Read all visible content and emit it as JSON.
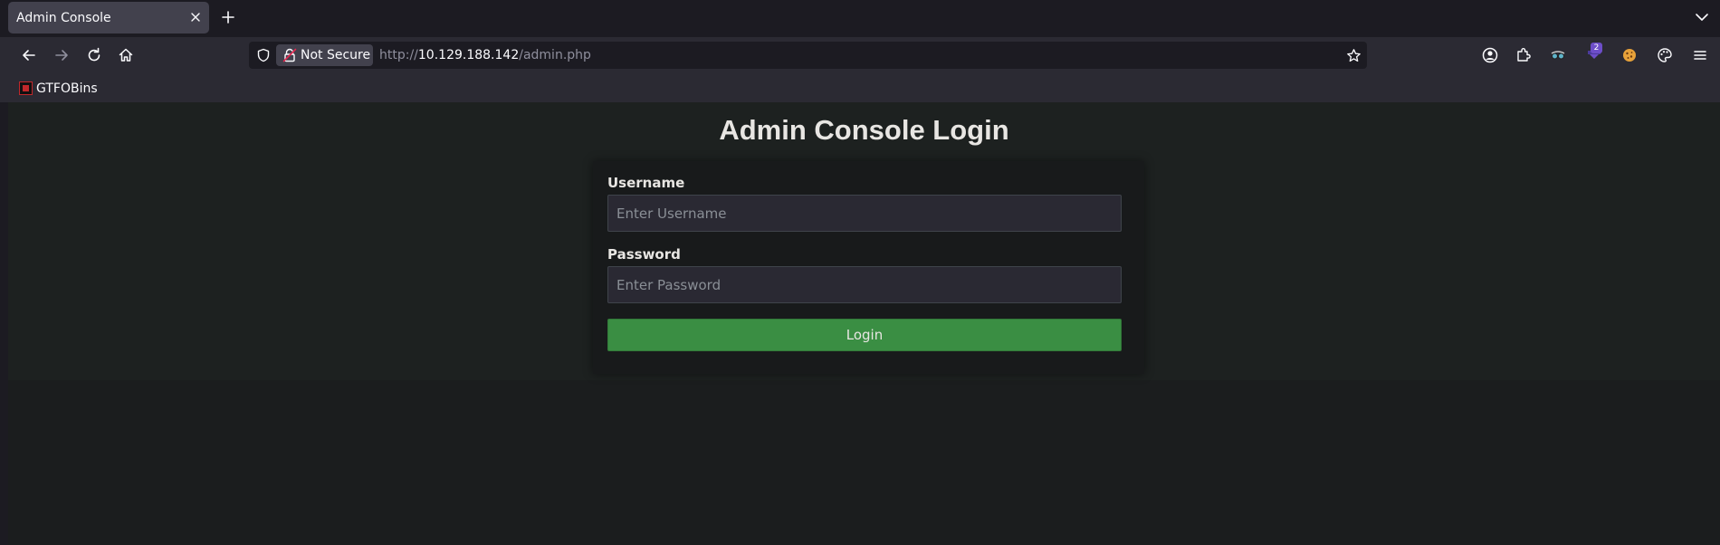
{
  "browser": {
    "tab": {
      "title": "Admin Console"
    },
    "navigation": {
      "security_label": "Not Secure",
      "url_scheme": "http://",
      "url_host": "10.129.188.142",
      "url_path": "/admin.php"
    },
    "extensions": {
      "badge_count": "2",
      "icons": [
        "account-icon",
        "extensions-icon",
        "spy-glasses-icon",
        "badge-extension-icon",
        "cookie-icon",
        "palette-icon",
        "menu-icon"
      ]
    },
    "bookmarks": [
      {
        "label": "GTFOBins"
      }
    ]
  },
  "page": {
    "title": "Admin Console Login",
    "form": {
      "username_label": "Username",
      "username_placeholder": "Enter Username",
      "password_label": "Password",
      "password_placeholder": "Enter Password",
      "submit_label": "Login"
    }
  },
  "colors": {
    "chrome_dark": "#1c1b22",
    "chrome": "#2b2a33",
    "tab_active": "#42414d",
    "login_button": "#3a8e43",
    "page_background": "#1b1d1e"
  }
}
